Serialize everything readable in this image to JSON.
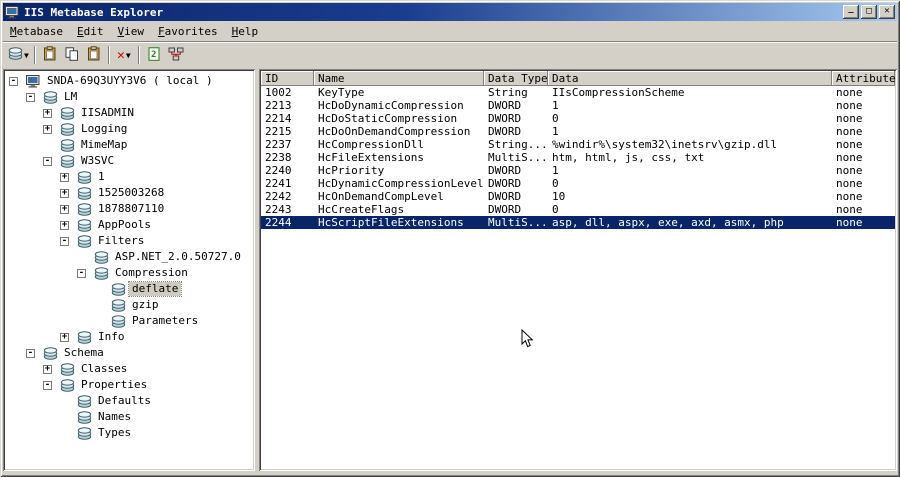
{
  "window": {
    "title": "IIS Metabase Explorer",
    "controls": [
      {
        "name": "minimize",
        "glyph": "_"
      },
      {
        "name": "maximize",
        "glyph": "□"
      },
      {
        "name": "close",
        "glyph": "✕"
      }
    ]
  },
  "menu": {
    "items": [
      {
        "label": "Metabase"
      },
      {
        "label": "Edit"
      },
      {
        "label": "View"
      },
      {
        "label": "Favorites"
      },
      {
        "label": "Help"
      }
    ]
  },
  "toolbar": {
    "buttons": [
      {
        "name": "connect-button",
        "icon": "db",
        "dropdown": true
      },
      {
        "sep": true
      },
      {
        "name": "paste-button",
        "icon": "paste"
      },
      {
        "name": "copy-button",
        "icon": "copy"
      },
      {
        "name": "paste-special-button",
        "icon": "paste"
      },
      {
        "sep": true
      },
      {
        "name": "delete-button",
        "icon": "delete",
        "dropdown": true
      },
      {
        "sep": true
      },
      {
        "name": "export-button",
        "icon": "xml"
      },
      {
        "name": "network-button",
        "icon": "network"
      }
    ]
  },
  "tree": {
    "items": [
      {
        "label": "SNDA-69Q3UYY3V6 ( local )",
        "level": 0,
        "expand": "-",
        "icon": "computer"
      },
      {
        "label": "LM",
        "level": 1,
        "expand": "-",
        "icon": "db"
      },
      {
        "label": "IISADMIN",
        "level": 2,
        "expand": "+",
        "icon": "db"
      },
      {
        "label": "Logging",
        "level": 2,
        "expand": "+",
        "icon": "db"
      },
      {
        "label": "MimeMap",
        "level": 2,
        "expand": "",
        "icon": "db"
      },
      {
        "label": "W3SVC",
        "level": 2,
        "expand": "-",
        "icon": "db"
      },
      {
        "label": "1",
        "level": 3,
        "expand": "+",
        "icon": "db"
      },
      {
        "label": "1525003268",
        "level": 3,
        "expand": "+",
        "icon": "db"
      },
      {
        "label": "1878807110",
        "level": 3,
        "expand": "+",
        "icon": "db"
      },
      {
        "label": "AppPools",
        "level": 3,
        "expand": "+",
        "icon": "db"
      },
      {
        "label": "Filters",
        "level": 3,
        "expand": "-",
        "icon": "db"
      },
      {
        "label": "ASP.NET_2.0.50727.0",
        "level": 4,
        "expand": "",
        "icon": "db"
      },
      {
        "label": "Compression",
        "level": 4,
        "expand": "-",
        "icon": "db"
      },
      {
        "label": "deflate",
        "level": 5,
        "expand": "",
        "icon": "db",
        "selected": true
      },
      {
        "label": "gzip",
        "level": 5,
        "expand": "",
        "icon": "db"
      },
      {
        "label": "Parameters",
        "level": 5,
        "expand": "",
        "icon": "db"
      },
      {
        "label": "Info",
        "level": 3,
        "expand": "+",
        "icon": "db"
      },
      {
        "label": "Schema",
        "level": 1,
        "expand": "-",
        "icon": "db"
      },
      {
        "label": "Classes",
        "level": 2,
        "expand": "+",
        "icon": "db"
      },
      {
        "label": "Properties",
        "level": 2,
        "expand": "-",
        "icon": "db"
      },
      {
        "label": "Defaults",
        "level": 3,
        "expand": "",
        "icon": "db"
      },
      {
        "label": "Names",
        "level": 3,
        "expand": "",
        "icon": "db"
      },
      {
        "label": "Types",
        "level": 3,
        "expand": "",
        "icon": "db"
      }
    ]
  },
  "table": {
    "columns": [
      "ID",
      "Name",
      "Data Type",
      "Data",
      "Attributes"
    ],
    "rows": [
      {
        "cells": [
          "1002",
          "KeyType",
          "String",
          "IIsCompressionScheme",
          "none"
        ],
        "selected": false
      },
      {
        "cells": [
          "2213",
          "HcDoDynamicCompression",
          "DWORD",
          "1",
          "none"
        ],
        "selected": false
      },
      {
        "cells": [
          "2214",
          "HcDoStaticCompression",
          "DWORD",
          "0",
          "none"
        ],
        "selected": false
      },
      {
        "cells": [
          "2215",
          "HcDoOnDemandCompression",
          "DWORD",
          "1",
          "none"
        ],
        "selected": false
      },
      {
        "cells": [
          "2237",
          "HcCompressionDll",
          "String...",
          "%windir%\\system32\\inetsrv\\gzip.dll",
          "none"
        ],
        "selected": false
      },
      {
        "cells": [
          "2238",
          "HcFileExtensions",
          "MultiS...",
          "htm, html, js, css, txt",
          "none"
        ],
        "selected": false
      },
      {
        "cells": [
          "2240",
          "HcPriority",
          "DWORD",
          "1",
          "none"
        ],
        "selected": false
      },
      {
        "cells": [
          "2241",
          "HcDynamicCompressionLevel",
          "DWORD",
          "0",
          "none"
        ],
        "selected": false
      },
      {
        "cells": [
          "2242",
          "HcOnDemandCompLevel",
          "DWORD",
          "10",
          "none"
        ],
        "selected": false
      },
      {
        "cells": [
          "2243",
          "HcCreateFlags",
          "DWORD",
          "0",
          "none"
        ],
        "selected": false
      },
      {
        "cells": [
          "2244",
          "HcScriptFileExtensions",
          "MultiS...",
          "asp, dll, aspx, exe, axd, asmx, php",
          "none"
        ],
        "selected": true
      }
    ]
  },
  "colors": {
    "chrome": "#d4d0c8",
    "titlebar_start": "#0a246a",
    "titlebar_end": "#a6caf0",
    "selection": "#0a246a",
    "inactive_selection": "#cfcbc0"
  }
}
